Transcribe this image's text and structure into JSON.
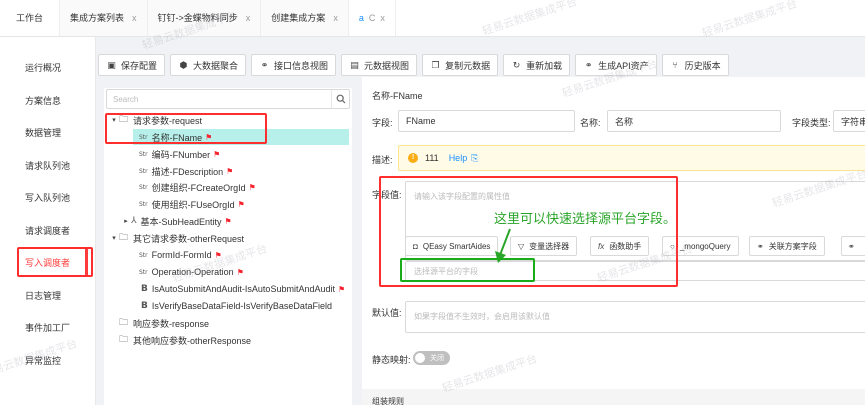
{
  "tabs": [
    {
      "label": "工作台"
    },
    {
      "label": "集成方案列表",
      "close": "x"
    },
    {
      "label": "钉钉->金蝶物料同步",
      "close": "x"
    },
    {
      "label": "创建集成方案",
      "close": "x"
    },
    {
      "label": "a",
      "ctl1": "C",
      "ctl2": "x"
    }
  ],
  "sidebar": {
    "items": [
      {
        "label": "运行概况"
      },
      {
        "label": "方案信息"
      },
      {
        "label": "数据管理"
      },
      {
        "label": "请求队列池"
      },
      {
        "label": "写入队列池"
      },
      {
        "label": "请求调度者"
      },
      {
        "label": "写入调度者"
      },
      {
        "label": "日志管理"
      },
      {
        "label": "事件加工厂"
      },
      {
        "label": "异常监控"
      }
    ],
    "active_index": 6
  },
  "toolbar": {
    "buttons": [
      {
        "label": "保存配置",
        "icon": "save-icon"
      },
      {
        "label": "大数据聚合",
        "icon": "cube-icon"
      },
      {
        "label": "接口信息视图",
        "icon": "link-icon"
      },
      {
        "label": "元数据视图",
        "icon": "terminal-icon"
      },
      {
        "label": "复制元数据",
        "icon": "copy-icon"
      },
      {
        "label": "重新加载",
        "icon": "reload-icon"
      },
      {
        "label": "生成API资产",
        "icon": "link-icon"
      },
      {
        "label": "历史版本",
        "icon": "branch-icon"
      }
    ]
  },
  "tree": {
    "search_placeholder": "Search",
    "nodes": [
      {
        "arrow": "▾",
        "folder": true,
        "label": "请求参数-request"
      },
      {
        "tag": "Str",
        "label": "名称-FName",
        "flag": true,
        "selected": true
      },
      {
        "tag": "Str",
        "label": "编码-FNumber",
        "flag": true
      },
      {
        "tag": "Str",
        "label": "描述-FDescription",
        "flag": true
      },
      {
        "tag": "Str",
        "label": "创建组织-FCreateOrgId",
        "flag": true
      },
      {
        "tag": "Str",
        "label": "使用组织-FUseOrgId",
        "flag": true
      },
      {
        "arrow": "▸",
        "tag": "⅄",
        "label": "基本-SubHeadEntity",
        "flag": true
      },
      {
        "arrow": "▾",
        "folder": true,
        "label": "其它请求参数-otherRequest"
      },
      {
        "tag": "Str",
        "label": "FormId-FormId",
        "flag": true
      },
      {
        "tag": "Str",
        "label": "Operation-Operation",
        "flag": true
      },
      {
        "tag": "B",
        "label": "IsAutoSubmitAndAudit-IsAutoSubmitAndAudit",
        "flag": true
      },
      {
        "tag": "B",
        "label": "IsVerifyBaseDataField-IsVerifyBaseDataField"
      },
      {
        "folder": true,
        "label": "响应参数-response"
      },
      {
        "folder": true,
        "label": "其他响应参数-otherResponse"
      }
    ]
  },
  "detail": {
    "title": "名称-FName",
    "field_label": "字段:",
    "field_value": "FName",
    "name_label": "名称:",
    "name_value": "名称",
    "type_label": "字段类型:",
    "type_value": "字符串",
    "desc_label": "描述:",
    "desc_warn": "!",
    "desc_value": "111",
    "desc_help": "Help",
    "value_label": "字段值:",
    "value_placeholder": "请输入该字段配置的属性值",
    "annotation": "这里可以快速选择源平台字段。",
    "helpers": [
      {
        "label": "QEasy SmartAides",
        "icon": "robot-icon"
      },
      {
        "label": "变量选择器",
        "icon": "filter-icon"
      },
      {
        "label": "函数助手",
        "icon": "function-icon"
      },
      {
        "label": "_mongoQuery",
        "icon": "search-icon"
      },
      {
        "label": "关联方案字段",
        "icon": "link-icon"
      }
    ],
    "source_placeholder": "选择源平台的字段",
    "default_label": "默认值:",
    "default_placeholder": "如果字段值不生效时，会启用该默认值",
    "static_label": "静态映射:",
    "switch_text": "关闭",
    "bottom_label": "组装规则"
  },
  "watermark": "轻易云数据集成平台",
  "colors": {
    "accent": "#1890ff",
    "highlight_red": "#ff2e2e",
    "highlight_green": "#1aad19",
    "selected_bg": "#b7f0ea"
  }
}
